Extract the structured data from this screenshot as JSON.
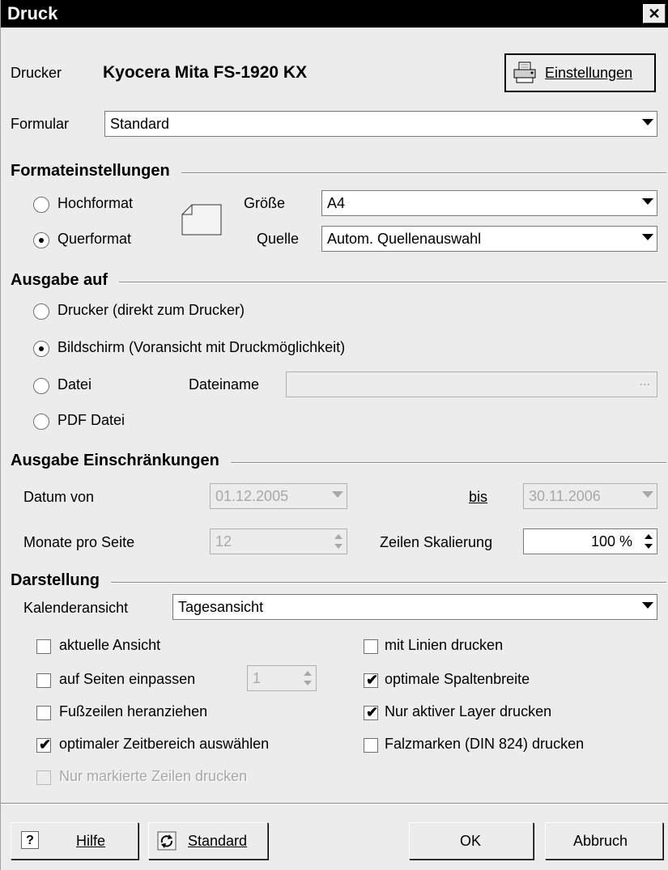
{
  "window": {
    "title": "Druck",
    "close_symbol": "✕"
  },
  "printer": {
    "label": "Drucker",
    "name": "Kyocera Mita FS-1920 KX",
    "settings_button": "Einstellungen"
  },
  "form": {
    "label": "Formular",
    "value": "Standard"
  },
  "format_settings": {
    "title": "Formateinstellungen",
    "portrait_label": "Hochformat",
    "landscape_label": "Querformat",
    "selected": "Querformat",
    "size_label": "Größe",
    "size_value": "A4",
    "source_label": "Quelle",
    "source_value": "Autom. Quellenauswahl"
  },
  "output": {
    "title": "Ausgabe auf",
    "options": [
      "Drucker (direkt zum Drucker)",
      "Bildschirm (Voransicht mit Druckmöglichkeit)",
      "Datei",
      "PDF Datei"
    ],
    "selected": "Bildschirm (Voransicht mit Druckmöglichkeit)",
    "filename_label": "Dateiname",
    "filename_value": "",
    "filename_button": "..."
  },
  "restrictions": {
    "title": "Ausgabe Einschränkungen",
    "date_from_label": "Datum von",
    "date_from_value": "01.12.2005",
    "date_to_label": "bis",
    "date_to_value": "30.11.2006",
    "months_label": "Monate pro Seite",
    "months_value": "12",
    "row_scale_label": "Zeilen Skalierung",
    "row_scale_value": "100 %"
  },
  "display": {
    "title": "Darstellung",
    "calendar_view_label": "Kalenderansicht",
    "calendar_view_value": "Tagesansicht",
    "checkboxes": [
      {
        "label": "aktuelle Ansicht",
        "checked": false,
        "enabled": true
      },
      {
        "label": "auf Seiten einpassen",
        "checked": false,
        "enabled": true
      },
      {
        "label": "Fußzeilen heranziehen",
        "checked": false,
        "enabled": true
      },
      {
        "label": "optimaler Zeitbereich auswählen",
        "checked": true,
        "enabled": true
      },
      {
        "label": "Nur markierte Zeilen drucken",
        "checked": false,
        "enabled": false
      },
      {
        "label": "mit Linien drucken",
        "checked": false,
        "enabled": true
      },
      {
        "label": "optimale Spaltenbreite",
        "checked": true,
        "enabled": true
      },
      {
        "label": "Nur aktiver Layer drucken",
        "checked": true,
        "enabled": true
      },
      {
        "label": "Falzmarken (DIN 824) drucken",
        "checked": false,
        "enabled": true
      }
    ],
    "fit_pages_value": "1"
  },
  "buttons": {
    "help": "Hilfe",
    "help_icon": "?",
    "default": "Standard",
    "ok": "OK",
    "cancel": "Abbruch"
  }
}
